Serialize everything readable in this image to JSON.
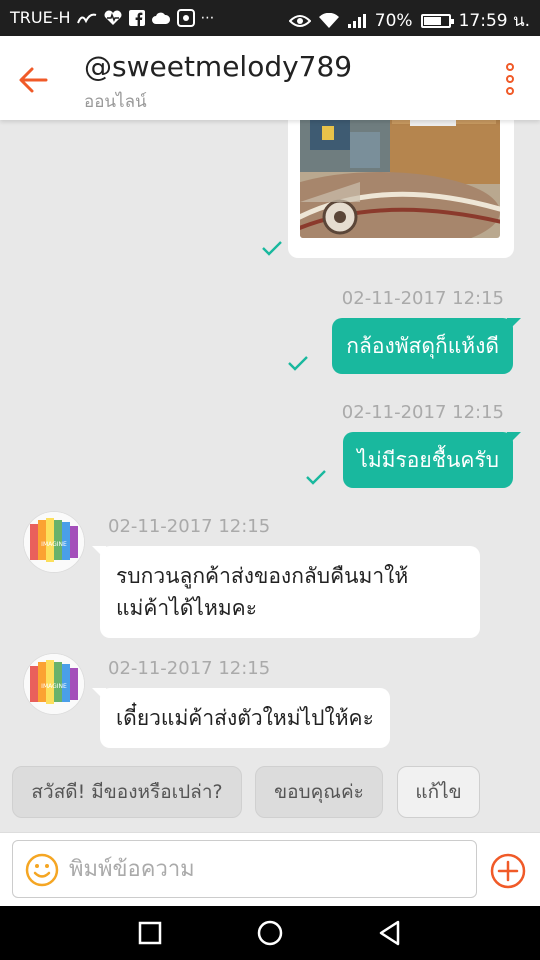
{
  "status_bar": {
    "carrier": "TRUE-H",
    "battery": "70%",
    "battery_level": 0.7,
    "time": "17:59 น."
  },
  "header": {
    "contact_name": "@sweetmelody789",
    "status": "ออนไลน์"
  },
  "messages": [
    {
      "timestamp": "02-11-2017 12:15",
      "text": "กล้องพัสดุก็แห้งดี"
    },
    {
      "timestamp": "02-11-2017 12:15",
      "text": "ไม่มีรอยชื้นครับ"
    },
    {
      "timestamp": "02-11-2017 12:15",
      "text": "รบกวนลูกค้าส่งของกลับคืนมาให้",
      "text2": "แม่ค้าได้ไหมคะ"
    },
    {
      "timestamp": "02-11-2017 12:15",
      "text": "เดี๋ยวแม่ค้าส่งตัวใหม่ไปให้คะ"
    }
  ],
  "avatar_caption": "IMAGINE",
  "quick_replies": [
    "สวัสดี! มีของหรือเปล่า?",
    "ขอบคุณค่ะ",
    "แก้ไข"
  ],
  "composer": {
    "placeholder": "พิมพ์ข้อความ"
  },
  "colors": {
    "accent": "#f05a28",
    "bubble_out": "#19b89e",
    "tick": "#19b89e",
    "emoji": "#f5a623"
  }
}
